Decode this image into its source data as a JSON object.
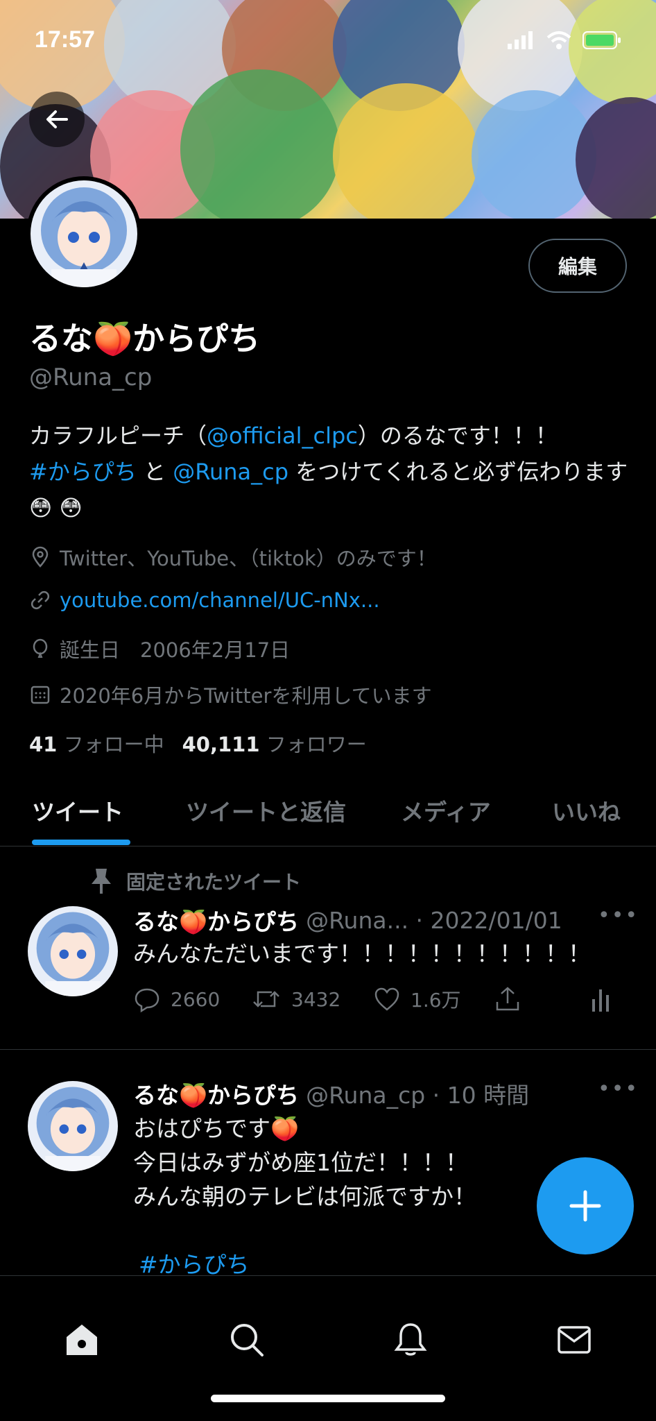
{
  "status_bar": {
    "time": "17:57"
  },
  "profile": {
    "name": "るな🍑からぴち",
    "handle": "@Runa_cp",
    "edit_label": "編集",
    "bio": {
      "part1": "カラフルピーチ（",
      "mention1": "@official_clpc",
      "part2": "）のるなです！！！",
      "hashtag": "#からぴち",
      "part3": " と ",
      "mention2": "@Runa_cp",
      "part4": " をつけてくれると必ず伝わります😳 😳"
    },
    "location": "Twitter、YouTube、（tiktok）のみです！",
    "url": "youtube.com/channel/UC-nNx...",
    "birthday": "誕生日　2006年2月17日",
    "joined": "2020年6月からTwitterを利用しています",
    "following_count": "41",
    "following_label": "フォロー中",
    "followers_count": "40,111",
    "followers_label": "フォロワー"
  },
  "tabs": [
    {
      "label": "ツイート",
      "active": true
    },
    {
      "label": "ツイートと返信",
      "active": false
    },
    {
      "label": "メディア",
      "active": false
    },
    {
      "label": "いいね",
      "active": false
    }
  ],
  "tweets": [
    {
      "pinned_label": "固定されたツイート",
      "name": "るな🍑からぴち",
      "handle_time": "@Runa... · 2022/01/01",
      "text": "みんなただいまです！！！！！！！！！！！",
      "replies": "2660",
      "retweets": "3432",
      "likes": "1.6万"
    },
    {
      "name": "るな🍑からぴち",
      "handle_time": "@Runa_cp · 10 時間",
      "lines": [
        "おはぴちです🍑",
        "今日はみずがめ座1位だ！！！！",
        "みんな朝のテレビは何派ですか！"
      ],
      "hashtag": "#からぴち"
    }
  ],
  "colors": {
    "accent": "#1d9bf0",
    "background": "#000000",
    "secondary_text": "#71767b"
  },
  "icons": {
    "back": "arrow-left-icon",
    "location": "location-pin-icon",
    "link": "link-icon",
    "birthday": "balloon-icon",
    "calendar": "calendar-icon",
    "pin": "pin-icon",
    "reply": "reply-icon",
    "retweet": "retweet-icon",
    "like": "heart-icon",
    "share": "share-icon",
    "analytics": "analytics-icon",
    "compose": "plus-icon",
    "nav": [
      "home-icon",
      "search-icon",
      "bell-icon",
      "mail-icon"
    ]
  }
}
